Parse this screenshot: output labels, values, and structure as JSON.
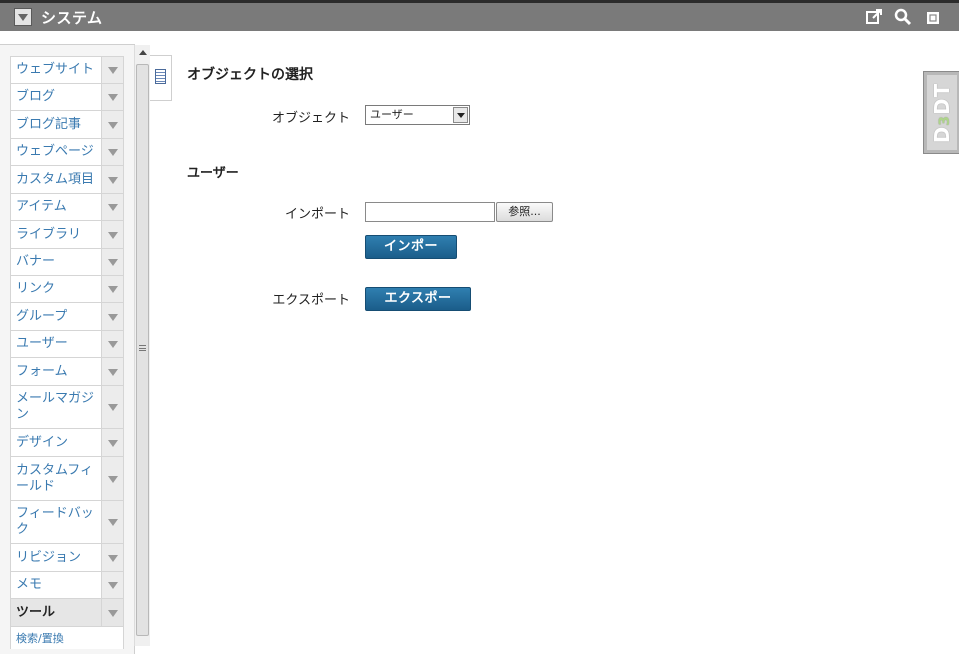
{
  "header": {
    "title": "システム"
  },
  "sidebar": {
    "items": [
      {
        "label": "ウェブサイト"
      },
      {
        "label": "ブログ"
      },
      {
        "label": "ブログ記事"
      },
      {
        "label": "ウェブページ"
      },
      {
        "label": "カスタム項目"
      },
      {
        "label": "アイテム"
      },
      {
        "label": "ライブラリ"
      },
      {
        "label": "バナー"
      },
      {
        "label": "リンク"
      },
      {
        "label": "グループ"
      },
      {
        "label": "ユーザー"
      },
      {
        "label": "フォーム"
      },
      {
        "label": "メールマガジン"
      },
      {
        "label": "デザイン"
      },
      {
        "label": "カスタムフィールド"
      },
      {
        "label": "フィードバック"
      },
      {
        "label": "リビジョン"
      },
      {
        "label": "メモ"
      },
      {
        "label": "ツール",
        "active": true
      }
    ],
    "subitem": "検索/置換"
  },
  "main": {
    "object_section_title": "オブジェクトの選択",
    "object_label": "オブジェクト",
    "object_selected": "ユーザー",
    "user_section_title": "ユーザー",
    "import_label": "インポート",
    "browse_label": "参照...",
    "import_button": "インポート",
    "export_label": "エクスポート",
    "export_button": "エクスポート"
  },
  "badge": {
    "text_main": "D",
    "text_sub": "3",
    "text_tail": "DT"
  },
  "colors": {
    "topbar": "#7a7a7a",
    "link": "#3a7ab0",
    "primary_button": "#1b5d8a"
  }
}
